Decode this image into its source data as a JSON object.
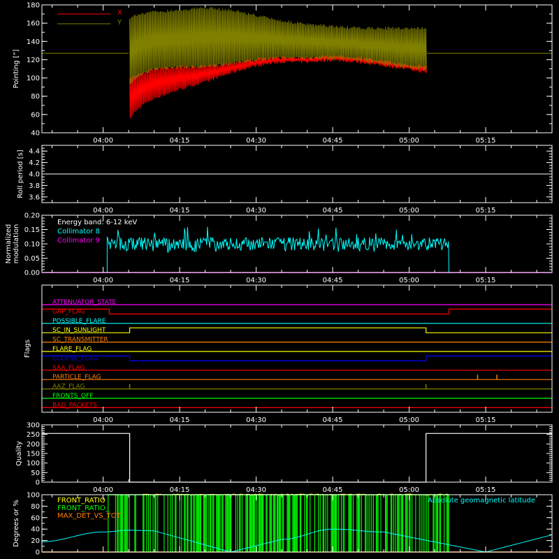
{
  "chart_data": [
    {
      "id": "pointing",
      "type": "line",
      "ylabel": "Pointing [\"]",
      "ylim": [
        40,
        180
      ],
      "yticks": [
        40,
        60,
        80,
        100,
        120,
        140,
        160,
        180
      ],
      "xtick_labels": [
        "04:00",
        "04:15",
        "04:30",
        "04:45",
        "05:00",
        "05:15"
      ],
      "xlim_minutes": [
        -12,
        88
      ],
      "xticks_minutes": [
        0,
        15,
        30,
        45,
        60,
        75
      ],
      "baseline_value": 127,
      "series": [
        {
          "name": "X",
          "color": "#ff0000",
          "t": [
            -12,
            4.9,
            5.2,
            6,
            8,
            10,
            15,
            20,
            25,
            30,
            35,
            40,
            45,
            50,
            55,
            60,
            63.5,
            63.6,
            88
          ],
          "lo": [
            127,
            127,
            52,
            60,
            70,
            76,
            86,
            94,
            104,
            112,
            116,
            116,
            118,
            116,
            112,
            108,
            104,
            127,
            127
          ],
          "hi": [
            127,
            127,
            100,
            104,
            108,
            112,
            114,
            114,
            118,
            122,
            124,
            124,
            126,
            124,
            120,
            116,
            114,
            127,
            127
          ]
        },
        {
          "name": "Y",
          "color": "#808000",
          "t": [
            -12,
            4.9,
            5.2,
            6,
            8,
            10,
            15,
            20,
            25,
            30,
            35,
            40,
            45,
            50,
            55,
            60,
            63.5,
            63.6,
            88
          ],
          "lo": [
            127,
            127,
            90,
            96,
            104,
            108,
            110,
            110,
            114,
            118,
            120,
            120,
            120,
            118,
            114,
            110,
            108,
            127,
            127
          ],
          "hi": [
            127,
            127,
            166,
            170,
            172,
            174,
            176,
            178,
            176,
            170,
            164,
            160,
            158,
            156,
            156,
            156,
            156,
            127,
            127
          ]
        }
      ]
    },
    {
      "id": "roll_period",
      "type": "line",
      "ylabel": "Roll period [s]",
      "ylim": [
        3.5,
        4.5
      ],
      "yticks": [
        3.6,
        3.8,
        4.0,
        4.2,
        4.4
      ],
      "ytick_labels": [
        "3.6",
        "3.8",
        "4.0",
        "4.2",
        "4.4"
      ],
      "xtick_labels": [
        "04:00",
        "04:15",
        "04:30",
        "04:45",
        "05:00",
        "05:15"
      ],
      "series": [
        {
          "name": "roll period",
          "color": "#ffffff",
          "t": [
            -12,
            88
          ],
          "values": [
            4.0,
            4.0
          ]
        }
      ]
    },
    {
      "id": "modulation",
      "type": "line",
      "ylabel_line1": "Normalized",
      "ylabel_line2": "modulation",
      "ylim": [
        0,
        0.2
      ],
      "yticks": [
        0,
        0.05,
        0.1,
        0.15,
        0.2
      ],
      "ytick_labels": [
        "0.00",
        "0.05",
        "0.10",
        "0.15",
        "0.20"
      ],
      "xtick_labels": [
        "04:00",
        "04:15",
        "04:30",
        "04:45",
        "05:00",
        "05:15"
      ],
      "legend_header": "Energy band: 6-12 keV",
      "series": [
        {
          "name": "Collimator 8",
          "color": "#00ffff",
          "t_start": 0.8,
          "t_end": 67.8,
          "mean": 0.1,
          "min": 0.07,
          "max": 0.16
        },
        {
          "name": "Collimator 9",
          "color": "#ff00ff",
          "t": [
            -12,
            88
          ],
          "values": [
            0,
            0
          ]
        }
      ]
    },
    {
      "id": "flags",
      "type": "line",
      "ylabel": "Flags",
      "xtick_labels": [
        "04:00",
        "04:15",
        "04:30",
        "04:45",
        "05:00",
        "05:15"
      ],
      "series": [
        {
          "name": "ATTENUATOR_STATE",
          "color": "#ff00ff",
          "raises": []
        },
        {
          "name": "GAP_FLAG",
          "color": "#ff0000",
          "raises": [
            [
              -12,
              1
            ],
            [
              1.2,
              0
            ],
            [
              67.8,
              1
            ],
            [
              88,
              1
            ]
          ]
        },
        {
          "name": "POSSIBLE_FLARE",
          "color": "#00ffff",
          "raises": []
        },
        {
          "name": "SC_IN_SUNLIGHT",
          "color": "#ffff00",
          "raises": [
            [
              -12,
              0
            ],
            [
              5.2,
              1
            ],
            [
              63.3,
              0
            ],
            [
              88,
              0
            ]
          ]
        },
        {
          "name": "SC_TRANSMITTER",
          "color": "#ff8000",
          "raises": []
        },
        {
          "name": "FLARE_FLAG",
          "color": "#ffff00",
          "raises": []
        },
        {
          "name": "ECLIPSE_FLAG",
          "color": "#0000ff",
          "raises": [
            [
              -12,
              1
            ],
            [
              5.2,
              0
            ],
            [
              63.3,
              1
            ],
            [
              88,
              1
            ]
          ]
        },
        {
          "name": "SAA_FLAG",
          "color": "#ff0000",
          "raises": []
        },
        {
          "name": "PARTICLE_FLAG",
          "color": "#ff8000",
          "spikes": [
            73.4,
            77.2
          ]
        },
        {
          "name": "AAZ_FLAG",
          "color": "#808000",
          "spikes": [
            5.2,
            63.3
          ]
        },
        {
          "name": "FRONTS_OFF",
          "color": "#00ff00",
          "raises": []
        },
        {
          "name": "BAD_PACKETS",
          "color": "#ff0000",
          "raises": []
        }
      ]
    },
    {
      "id": "quality",
      "type": "line",
      "ylabel": "Quality",
      "ylim": [
        0,
        300
      ],
      "yticks": [
        0,
        50,
        100,
        150,
        200,
        250,
        300
      ],
      "ytick_labels": [
        "0",
        "50",
        "100",
        "150",
        "200",
        "250",
        "300"
      ],
      "xtick_labels": [
        "04:00",
        "04:15",
        "04:30",
        "04:45",
        "05:00",
        "05:15"
      ],
      "series": [
        {
          "name": "Quality",
          "color": "#ffffff",
          "t": [
            -12,
            5.2,
            5.2,
            63.3,
            63.3,
            88
          ],
          "values": [
            255,
            255,
            0,
            0,
            255,
            255
          ]
        }
      ]
    },
    {
      "id": "ratios",
      "type": "line",
      "ylabel": "Degrees or %",
      "ylim": [
        0,
        100
      ],
      "yticks": [
        0,
        20,
        40,
        60,
        80,
        100
      ],
      "ytick_labels": [
        "0",
        "20",
        "40",
        "60",
        "80",
        "100"
      ],
      "xtick_labels": [
        "04:00",
        "04:15",
        "04:30",
        "04:45",
        "05:00",
        "05:15"
      ],
      "annotation": "Absolute geomagnetic latitude",
      "series": [
        {
          "name": "FRONT_RATIO",
          "color": "#ffff00",
          "t_start": 0.8,
          "t_end": 67.8,
          "values_level": 100
        },
        {
          "name": "FRONT_RATIO_",
          "color": "#00ff00",
          "t_start": 0.8,
          "t_end": 67.8,
          "values_level": 100
        },
        {
          "name": "MAX_DET_VS_TOT",
          "color": "#ff8000",
          "t": [
            -12,
            88
          ],
          "values": [
            0,
            0
          ]
        },
        {
          "name": "Absolute geomagnetic latitude",
          "color": "#00ffff",
          "t": [
            -12,
            0,
            5,
            10,
            25,
            35,
            45,
            55,
            75,
            88
          ],
          "values": [
            18,
            35,
            38,
            37,
            0,
            22,
            40,
            35,
            0,
            30
          ]
        }
      ]
    }
  ]
}
